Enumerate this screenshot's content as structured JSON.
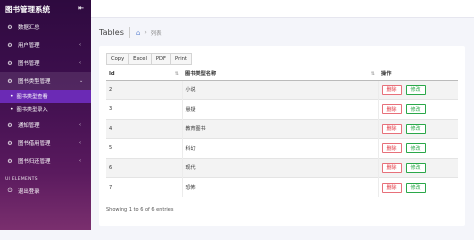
{
  "app": {
    "title": "图书管理系统",
    "toggle_icon": "collapse-icon"
  },
  "sidebar": {
    "items": [
      {
        "label": "数据汇总",
        "icon": "dashboard-icon"
      },
      {
        "label": "用户管理",
        "icon": "user-icon"
      },
      {
        "label": "图书管理",
        "icon": "book-icon"
      },
      {
        "label": "图书类型管理",
        "icon": "category-icon"
      },
      {
        "label": "通知管理",
        "icon": "notice-icon"
      },
      {
        "label": "图书借用管理",
        "icon": "borrow-icon"
      },
      {
        "label": "图书归还管理",
        "icon": "return-icon"
      }
    ],
    "subitems": [
      {
        "label": "图书类型查看"
      },
      {
        "label": "图书类型录入"
      }
    ],
    "section_title": "UI ELEMENTS",
    "logout": {
      "label": "退出登录",
      "icon": "logout-icon"
    }
  },
  "breadcrumb": {
    "title": "Tables",
    "current": "列表"
  },
  "toolbar": {
    "copy": "Copy",
    "excel": "Excel",
    "pdf": "PDF",
    "print": "Print"
  },
  "table": {
    "headers": [
      "Id",
      "图书类型名称",
      "操作"
    ],
    "rows": [
      {
        "id": "2",
        "name": "小说"
      },
      {
        "id": "3",
        "name": "悬疑"
      },
      {
        "id": "4",
        "name": "教育图书"
      },
      {
        "id": "5",
        "name": "科幻"
      },
      {
        "id": "6",
        "name": "现代"
      },
      {
        "id": "7",
        "name": "恐怖"
      }
    ],
    "delete_label": "删除",
    "edit_label": "修改"
  },
  "footer": {
    "info": "Showing 1 to 6 of 6 entries"
  },
  "colors": {
    "sidebar_top": "#2e0a3f",
    "sidebar_bottom": "#7a2f6e",
    "current_sub": "#6b2ab5",
    "delete": "#e2343e",
    "edit": "#2ba84a"
  }
}
